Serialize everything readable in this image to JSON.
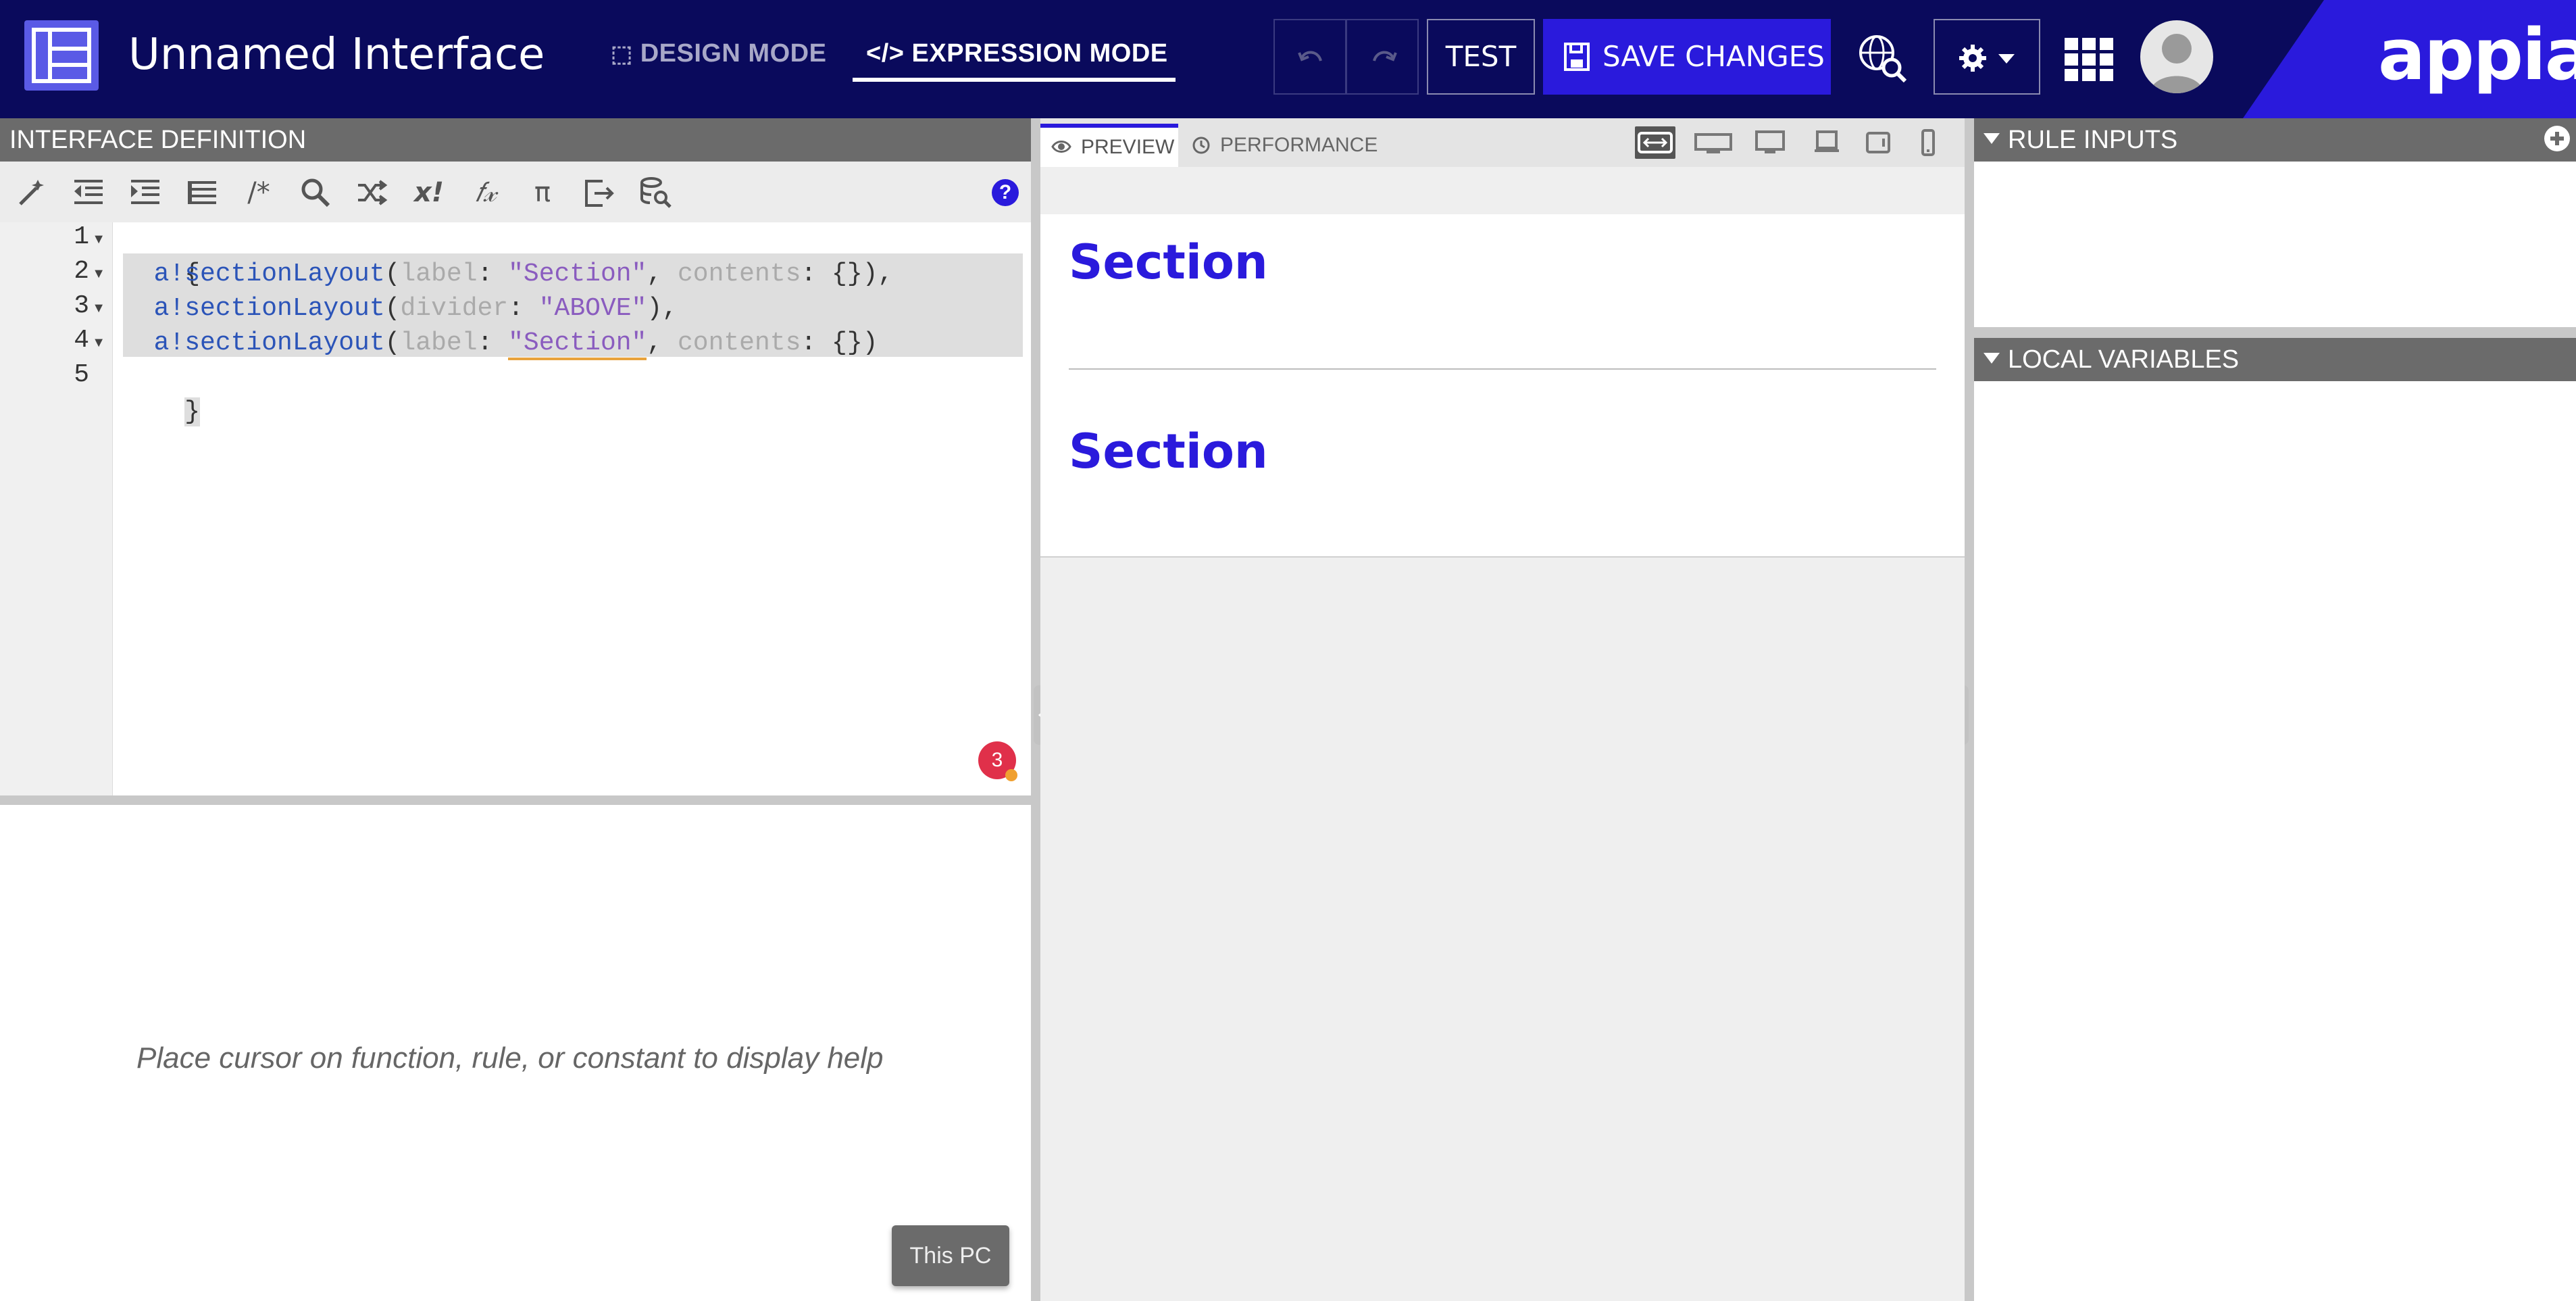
{
  "header": {
    "title": "Unnamed Interface",
    "design_mode": "DESIGN MODE",
    "expression_mode": "EXPRESSION MODE",
    "test_label": "TEST",
    "save_label": "SAVE CHANGES",
    "brand": "appian",
    "active_mode": "EXPRESSION MODE",
    "colors": {
      "bar": "#0a0a5c",
      "accent": "#2a1adc"
    }
  },
  "left_panel": {
    "title": "INTERFACE DEFINITION",
    "toolbar_icons": [
      "format-icon",
      "outdent-icon",
      "indent-icon",
      "list-icon",
      "comment-icon",
      "search-icon",
      "shuffle-icon",
      "not-icon",
      "function-icon",
      "pi-icon",
      "export-icon",
      "data-search-icon",
      "help-icon"
    ],
    "toolbar_glyphs": {
      "comment": "/*",
      "not": "x!",
      "function": "𝑓𝓍",
      "pi": "π",
      "help": "?"
    },
    "code_lines": [
      {
        "num": "1",
        "text": "{"
      },
      {
        "num": "2",
        "text": "  a!sectionLayout(label: \"Section\", contents: {}),",
        "fn": "a!sectionLayout",
        "k1": "label",
        "v1": "\"Section\"",
        "k2": "contents",
        "v2": "{}"
      },
      {
        "num": "3",
        "text": "  a!sectionLayout(divider: \"ABOVE\"),",
        "fn": "a!sectionLayout",
        "k1": "divider",
        "v1": "\"ABOVE\""
      },
      {
        "num": "4",
        "text": "  a!sectionLayout(label: \"Section\", contents: {})",
        "fn": "a!sectionLayout",
        "k1": "label",
        "v1": "\"Section\"",
        "k2": "contents",
        "v2": "{}"
      },
      {
        "num": "5",
        "text": "}"
      }
    ],
    "error_count": "3",
    "help_text": "Place cursor on function, rule, or constant to display help",
    "this_pc": "This PC"
  },
  "preview": {
    "tab_preview": "PREVIEW",
    "tab_performance": "PERFORMANCE",
    "devices": [
      "fit-width-icon",
      "desktop-wide-icon",
      "desktop-icon",
      "laptop-icon",
      "tablet-icon",
      "phone-icon"
    ],
    "section_1": "Section",
    "section_2": "Section"
  },
  "right_panel": {
    "rule_inputs": "RULE INPUTS",
    "local_variables": "LOCAL VARIABLES"
  }
}
